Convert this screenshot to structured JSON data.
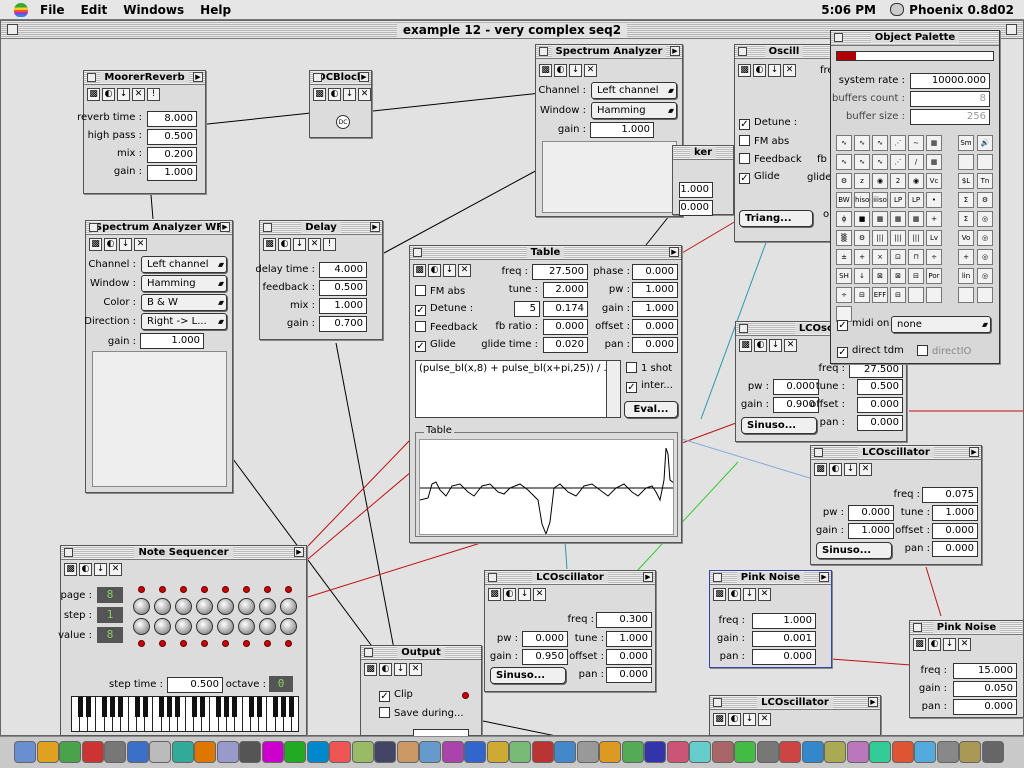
{
  "menubar": {
    "menus": [
      "File",
      "Edit",
      "Windows",
      "Help"
    ],
    "clock": "5:06 PM",
    "app_name": "Phoenix 0.8d02"
  },
  "document": {
    "title": "example 12 - very complex seq2"
  },
  "moorer": {
    "title": "MoorerReverb",
    "reverb_time_label": "reverb time :",
    "reverb_time": "8.000",
    "high_pass_label": "high pass :",
    "high_pass": "0.500",
    "mix_label": "mix :",
    "mix": "0.200",
    "gain_label": "gain :",
    "gain": "1.000"
  },
  "dcblock": {
    "title": "DCBlock",
    "icon": "DC"
  },
  "spectrum1": {
    "title": "Spectrum Analyzer",
    "channel_label": "Channel :",
    "channel": "Left channel",
    "window_label": "Window :",
    "window": "Hamming",
    "gain_label": "gain :",
    "gain": "1.000"
  },
  "osc_top": {
    "title": "Oscill",
    "freq_label": "fre",
    "detune": "Detune :",
    "fm_abs": "FM abs",
    "feedback": "Feedback",
    "glide": "Glide",
    "fb_label": "fb",
    "glide_label": "glide",
    "wave": "Triang...",
    "o_label": "o"
  },
  "ker": {
    "title": "ker",
    "v1": "1.000",
    "v2": "0.000"
  },
  "spectrum_wf": {
    "title": "Spectrum Analyzer WF",
    "channel_label": "Channel :",
    "channel": "Left channel",
    "window_label": "Window :",
    "window": "Hamming",
    "color_label": "Color :",
    "color": "B & W",
    "direction_label": "Direction :",
    "direction": "Right -> L...",
    "gain_label": "gain :",
    "gain": "1.000"
  },
  "delay": {
    "title": "Delay",
    "delay_time_label": "delay time :",
    "delay_time": "4.000",
    "feedback_label": "feedback :",
    "feedback": "0.500",
    "mix_label": "mix :",
    "mix": "1.000",
    "gain_label": "gain :",
    "gain": "0.700"
  },
  "table": {
    "title": "Table",
    "fm_abs": "FM abs",
    "detune": "Detune :",
    "detune_a": "5",
    "detune_b": "0.174",
    "feedback": "Feedback",
    "glide": "Glide",
    "freq_label": "freq :",
    "freq": "27.500",
    "tune_label": "tune :",
    "tune": "2.000",
    "fb_ratio_label": "fb ratio :",
    "fb_ratio": "0.000",
    "glide_time_label": "glide time :",
    "glide_time": "0.020",
    "phase_label": "phase :",
    "phase": "0.000",
    "pw_label": "pw :",
    "pw": "1.000",
    "gain_label": "gain :",
    "gain": "1.000",
    "offset_label": "offset :",
    "offset": "0.000",
    "pan_label": "pan :",
    "pan": "0.000",
    "formula": "(pulse_bl(x,8) + pulse_bl(x+pi,25)) / .6",
    "one_shot": "1 shot",
    "inter": "inter...",
    "eval": "Eval...",
    "graph_label": "Table"
  },
  "lco1": {
    "title": "LCOscill",
    "freq_label": "freq :",
    "freq": "27.500",
    "pw_label": "pw :",
    "pw": "0.000",
    "tune_label": "tune :",
    "tune": "0.500",
    "gain_label": "gain :",
    "gain": "0.900",
    "offset_label": "offset :",
    "offset": "0.000",
    "pan_label": "pan :",
    "pan": "0.000",
    "wave": "Sinuso..."
  },
  "lco2": {
    "title": "LCOscillator",
    "freq_label": "freq :",
    "freq": "0.075",
    "pw_label": "pw :",
    "pw": "0.000",
    "tune_label": "tune :",
    "tune": "1.000",
    "gain_label": "gain :",
    "gain": "1.000",
    "offset_label": "offset :",
    "offset": "0.000",
    "pan_label": "pan :",
    "pan": "0.000",
    "wave": "Sinuso..."
  },
  "lco3": {
    "title": "LCOscillator",
    "freq_label": "freq :",
    "freq": "0.300",
    "pw_label": "pw :",
    "pw": "0.000",
    "tune_label": "tune :",
    "tune": "1.000",
    "gain_label": "gain :",
    "gain": "0.950",
    "offset_label": "offset :",
    "offset": "0.000",
    "pan_label": "pan :",
    "pan": "0.000",
    "wave": "Sinuso..."
  },
  "lco4": {
    "title": "LCOscillator"
  },
  "pink1": {
    "title": "Pink Noise",
    "freq_label": "freq :",
    "freq": "1.000",
    "gain_label": "gain :",
    "gain": "0.001",
    "pan_label": "pan :",
    "pan": "0.000"
  },
  "pink2": {
    "title": "Pink Noise",
    "freq_label": "freq :",
    "freq": "15.000",
    "gain_label": "gain :",
    "gain": "0.050",
    "pan_label": "pan :",
    "pan": "0.000"
  },
  "sequencer": {
    "title": "Note Sequencer",
    "page_label": "page :",
    "page": "8",
    "step_label": "step :",
    "step": "1",
    "value_label": "value :",
    "value": "8",
    "step_time_label": "step time :",
    "step_time": "0.500",
    "octave_label": "octave :",
    "octave": "0"
  },
  "output": {
    "title": "Output",
    "clip": "Clip",
    "save_during": "Save during..."
  },
  "palette": {
    "title": "Object Palette",
    "system_rate_label": "system rate :",
    "system_rate": "10000.000",
    "buffers_count_label": "buffers count :",
    "buffers_count": "8",
    "buffer_size_label": "buffer size :",
    "buffer_size": "256",
    "midi_on": "midi on",
    "midi_value": "none",
    "direct_tdm": "direct tdm",
    "direct_io": "directIO",
    "load_percent": 12,
    "icons": [
      "∿",
      "∿",
      "∿",
      "⋰",
      "∼",
      "▦",
      "Sm",
      "🔊",
      "∿",
      "∿",
      "∿",
      "⋰",
      "∕",
      "▦",
      "",
      "",
      "⚙",
      "z",
      "◉",
      "2",
      "◉",
      "Vc",
      "$L",
      "Tn",
      "BW",
      "hiso",
      "iiiso",
      "LP",
      "LP",
      "•",
      "Σ",
      "⚙",
      "ϕ",
      "■",
      "▦",
      "▦",
      "▦",
      "+",
      "Σ",
      "◎",
      "▒",
      "⚙",
      "|||",
      "|||",
      "|||",
      "Lv",
      "Vo",
      "◎",
      "±",
      "+",
      "×",
      "⊡",
      "⊓",
      "÷",
      "+",
      "◎",
      "SH",
      "↓",
      "⊠",
      "⊠",
      "⊟",
      "Por",
      "lin",
      "◎",
      "÷",
      "⊟",
      "EFF",
      "⊟",
      "",
      "",
      "",
      "",
      ""
    ],
    "colors": {
      "load_bar": "#b00000"
    }
  },
  "dock": {
    "count": 44
  }
}
